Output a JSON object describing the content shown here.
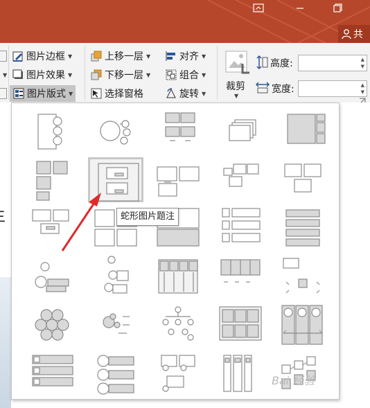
{
  "titlebar": {
    "share_label": "共",
    "colors": {
      "bar": "#b7472a",
      "share_bg": "#a0391f"
    }
  },
  "ribbon": {
    "left_col": [
      {
        "label": "图片边框",
        "icon": "pencil-border-icon"
      },
      {
        "label": "图片效果",
        "icon": "picture-effects-icon"
      },
      {
        "label": "图片版式",
        "icon": "picture-layout-icon"
      }
    ],
    "arrange_col1": [
      {
        "label": "上移一层",
        "icon": "bring-forward-icon"
      },
      {
        "label": "下移一层",
        "icon": "send-backward-icon"
      },
      {
        "label": "选择窗格",
        "icon": "selection-pane-icon"
      }
    ],
    "arrange_col2": [
      {
        "label": "对齐",
        "icon": "align-icon"
      },
      {
        "label": "组合",
        "icon": "group-icon"
      },
      {
        "label": "旋转",
        "icon": "rotate-icon"
      }
    ],
    "crop_label": "裁剪",
    "height_label": "高度:",
    "height_value": "",
    "width_label": "宽度:",
    "width_value": ""
  },
  "gallery": {
    "selected_index": 6,
    "tooltip": "蛇形图片题注",
    "layouts": [
      "vertical-circle-list",
      "circle-accent-timeline",
      "picture-grid",
      "picture-stack",
      "picture-frame-layout",
      "bending-picture-blocks",
      "snapshot-picture-list",
      "titled-picture-blocks",
      "picture-accent-blocks",
      "picture-caption-list",
      "captioned-pictures",
      "picture-block-list",
      "tiled-picture-grid",
      "vertical-picture-list",
      "horizontal-picture-blocks",
      "accent-process-circles",
      "circle-picture-hierarchy",
      "picture-column-list",
      "horizontal-picture-list",
      "framed-accent-picture",
      "hexagon-cluster",
      "circle-cluster",
      "picture-org-chart",
      "titled-picture-grid",
      "picture-arrow-process",
      "vertical-block-list",
      "circle-picture-list",
      "alternating-picture-blocks",
      "picture-column-stack",
      "picture-flow"
    ]
  },
  "watermark": "Bai 经验"
}
